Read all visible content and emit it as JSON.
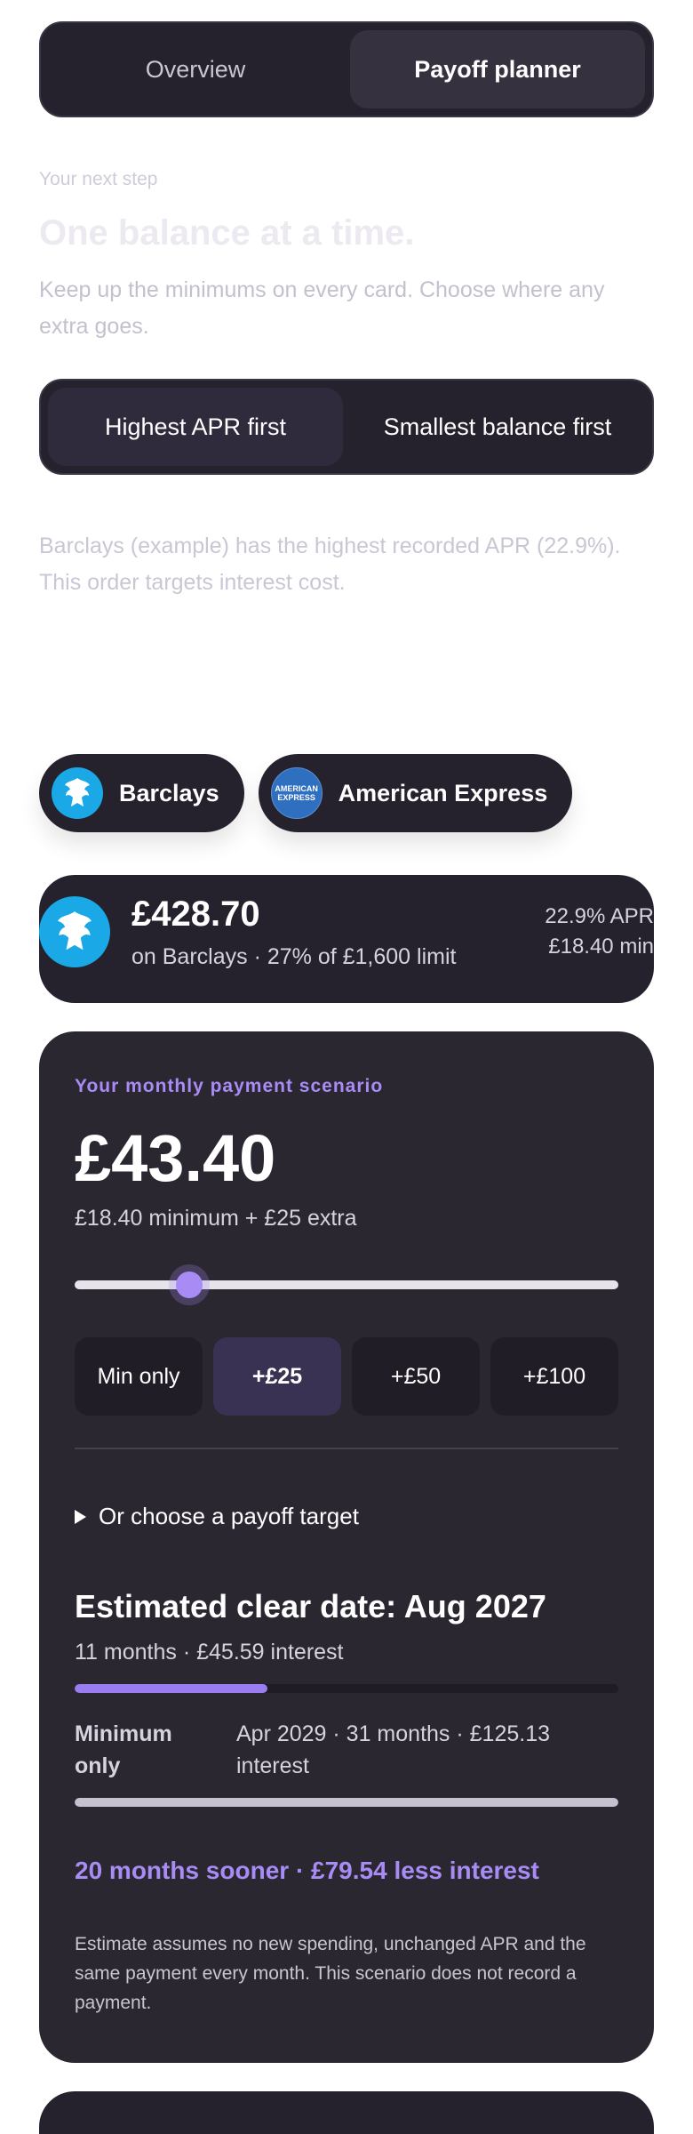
{
  "tabs": [
    {
      "label": "Overview",
      "active": false
    },
    {
      "label": "Payoff planner",
      "active": true
    }
  ],
  "intro": {
    "eyebrow": "Your next step",
    "headline": "One balance at a time.",
    "body": "Keep up the minimums on every card. Choose where any extra goes."
  },
  "strategy": {
    "options": [
      {
        "label": "Highest APR first",
        "active": true
      },
      {
        "label": "Smallest balance first",
        "active": false
      }
    ],
    "note": "Barclays (example) has the highest recorded APR (22.9%). This order targets interest cost."
  },
  "cards": [
    {
      "name": "Barclays",
      "icon": "barclays-eagle-icon",
      "color": "#1aa9e6"
    },
    {
      "name": "American Express",
      "icon": "amex-logo-icon",
      "color": "#2e6fbf",
      "logo_text": [
        "AMERICAN",
        "EXPRESS"
      ]
    }
  ],
  "balance": {
    "amount": "£428.70",
    "card": "on Barclays",
    "usage": "27% of £1,600 limit",
    "apr": "22.9% APR",
    "minimum": "£18.40 min"
  },
  "scenario": {
    "label": "Your monthly payment scenario",
    "amount": "£43.40",
    "split": "£18.40 minimum + £25 extra",
    "slider_fraction": 0.21,
    "presets": [
      {
        "label": "Min only",
        "active": false
      },
      {
        "label": "+£25",
        "active": true
      },
      {
        "label": "+£50",
        "active": false
      },
      {
        "label": "+£100",
        "active": false
      }
    ],
    "target_toggle": "Or choose a payoff target",
    "clear_date": "Estimated clear date: Aug 2027",
    "clear_months": "11 months",
    "clear_interest": "£45.59 interest",
    "scenario_bar_fraction": 0.355,
    "minimum_label": "Minimum only",
    "minimum_detail": "Apr 2029 · 31 months · £125.13 interest",
    "minimum_bar_fraction": 1.0,
    "saving": "20 months sooner · £79.54 less interest",
    "disclaimer": "Estimate assumes no new spending, unchanged APR and the same payment every month. This scenario does not record a payment."
  },
  "colors": {
    "accent": "#a98bf5",
    "card_bg": "#25222d",
    "barclays_blue": "#1aa9e6"
  }
}
